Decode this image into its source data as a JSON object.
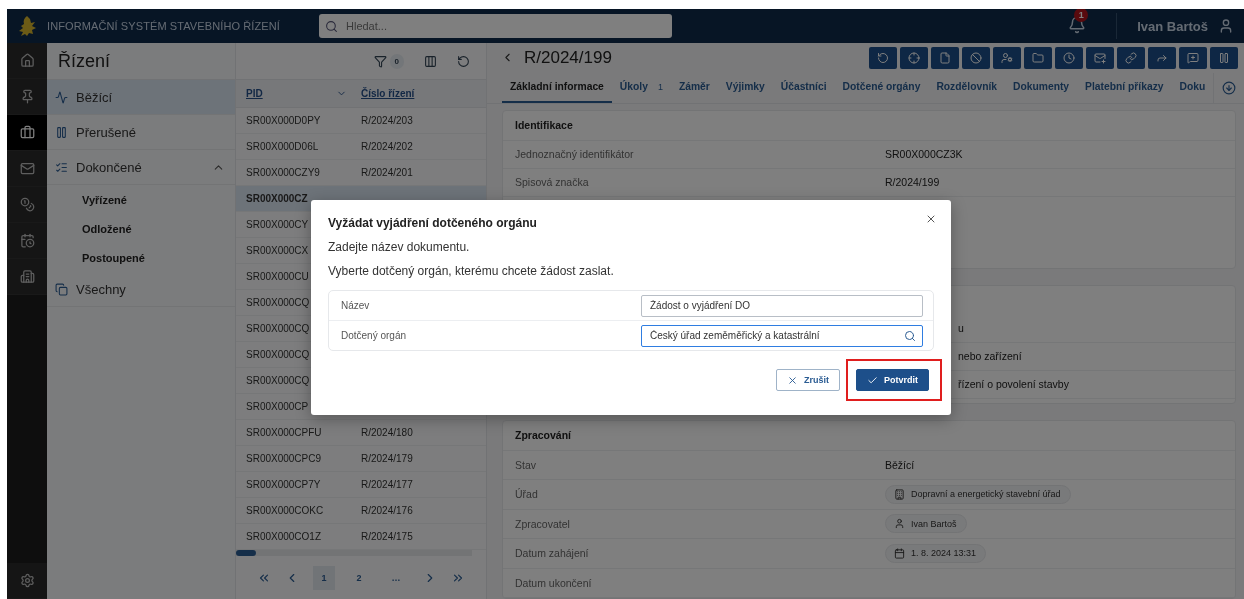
{
  "header": {
    "title": "INFORMAČNÍ SYSTÉM STAVEBNÍHO ŘÍZENÍ",
    "search": {
      "placeholder": "Hledat..."
    },
    "notifications": "1",
    "user": "Ivan Bartoš"
  },
  "rail": {
    "items": [
      {
        "selected": false
      },
      {
        "selected": false
      },
      {
        "selected": true
      },
      {
        "selected": false
      },
      {
        "selected": false
      },
      {
        "selected": false
      },
      {
        "selected": false
      }
    ]
  },
  "sidebar": {
    "title": "Řízení",
    "items": [
      {
        "label": "Běžící",
        "selected": true
      },
      {
        "label": "Přerušené",
        "selected": false
      },
      {
        "label": "Dokončené",
        "selected": false,
        "expanded": true,
        "children": [
          {
            "label": "Vyřízené",
            "selected": false
          },
          {
            "label": "Odložené",
            "selected": false
          },
          {
            "label": "Postoupené",
            "selected": false
          }
        ]
      },
      {
        "label": "Všechny",
        "selected": false
      }
    ]
  },
  "table": {
    "filter_count": "0",
    "columns": [
      {
        "label": "PID",
        "sorted": true
      },
      {
        "label": "Číslo řízení",
        "sorted": false
      }
    ],
    "rows": [
      {
        "pid": "SR00X000D0PY",
        "number": "R/2024/203",
        "selected": false
      },
      {
        "pid": "SR00X000D06L",
        "number": "R/2024/202",
        "selected": false
      },
      {
        "pid": "SR00X000CZY9",
        "number": "R/2024/201",
        "selected": false
      },
      {
        "pid": "SR00X000CZ",
        "selected": true
      },
      {
        "pid": "SR00X000CY",
        "selected": false
      },
      {
        "pid": "SR00X000CX",
        "selected": false
      },
      {
        "pid": "SR00X000CU",
        "selected": false
      },
      {
        "pid": "SR00X000CQ",
        "selected": false
      },
      {
        "pid": "SR00X000CQ",
        "selected": false
      },
      {
        "pid": "SR00X000CQ",
        "selected": false
      },
      {
        "pid": "SR00X000CQ",
        "selected": false
      },
      {
        "pid": "SR00X000CP",
        "selected": false
      },
      {
        "pid": "SR00X000CPFU",
        "number": "R/2024/180",
        "selected": false
      },
      {
        "pid": "SR00X000CPC9",
        "number": "R/2024/179",
        "selected": false
      },
      {
        "pid": "SR00X000CP7Y",
        "number": "R/2024/177",
        "selected": false
      },
      {
        "pid": "SR00X000COKC",
        "number": "R/2024/176",
        "selected": false
      },
      {
        "pid": "SR00X000CO1Z",
        "number": "R/2024/175",
        "selected": false
      }
    ],
    "pagination": [
      {
        "label": "1",
        "selected": true
      },
      {
        "label": "2",
        "selected": false
      },
      {
        "label": "…",
        "selected": false
      }
    ]
  },
  "detail": {
    "title": "R/2024/199",
    "tabs": [
      {
        "label": "Základní informace",
        "selected": true
      },
      {
        "label": "Úkoly",
        "count": "1",
        "selected": false
      },
      {
        "label": "Záměr",
        "selected": false
      },
      {
        "label": "Výjimky",
        "selected": false
      },
      {
        "label": "Účastníci",
        "selected": false
      },
      {
        "label": "Dotčené orgány",
        "selected": false
      },
      {
        "label": "Rozdělovník",
        "selected": false
      },
      {
        "label": "Dokumenty",
        "selected": false
      },
      {
        "label": "Platební příkazy",
        "selected": false
      },
      {
        "label": "Doku",
        "selected": false
      }
    ],
    "sections": [
      {
        "title": "Identifikace",
        "rows": [
          {
            "kind": "text",
            "label": "Jednoznačný identifikátor",
            "value": "SR00X000CZ3K"
          },
          {
            "kind": "text",
            "label": "Spisová značka",
            "value": "R/2024/199"
          }
        ]
      },
      {
        "rows": [
          {
            "kind": "clipped",
            "value": "u"
          },
          {
            "kind": "clipped",
            "value": "nebo zařízení"
          },
          {
            "kind": "clipped",
            "value": "řízení o povolení stavby"
          }
        ]
      },
      {
        "title": "Zpracování",
        "rows": [
          {
            "kind": "text",
            "label": "Stav",
            "value": "Běžící"
          },
          {
            "kind": "office",
            "label": "Úřad",
            "value": "Dopravní a energetický stavební úřad"
          },
          {
            "kind": "person",
            "label": "Zpracovatel",
            "value": "Ivan Bartoš"
          },
          {
            "kind": "date",
            "label": "Datum zahájení",
            "value": "1. 8. 2024 13:31"
          },
          {
            "kind": "text",
            "label": "Datum ukončení"
          }
        ]
      }
    ]
  },
  "dialog": {
    "title": "Vyžádat vyjádření dotčeného orgánu",
    "lines": [
      "Zadejte název dokumentu.",
      "Vyberte dotčený orgán, kterému chcete žádost zaslat."
    ],
    "fields": [
      {
        "kind": "text",
        "label": "Název",
        "value": "Žádost o vyjádření DO",
        "focused": false
      },
      {
        "kind": "search",
        "label": "Dotčený orgán",
        "value": "Český úřad zeměměřický a katastrální",
        "focused": true
      }
    ],
    "buttons": [
      {
        "kind": "cancel",
        "label": "Zrušit",
        "highlighted": false
      },
      {
        "kind": "confirm",
        "label": "Potvrdit",
        "highlighted": true
      }
    ]
  }
}
